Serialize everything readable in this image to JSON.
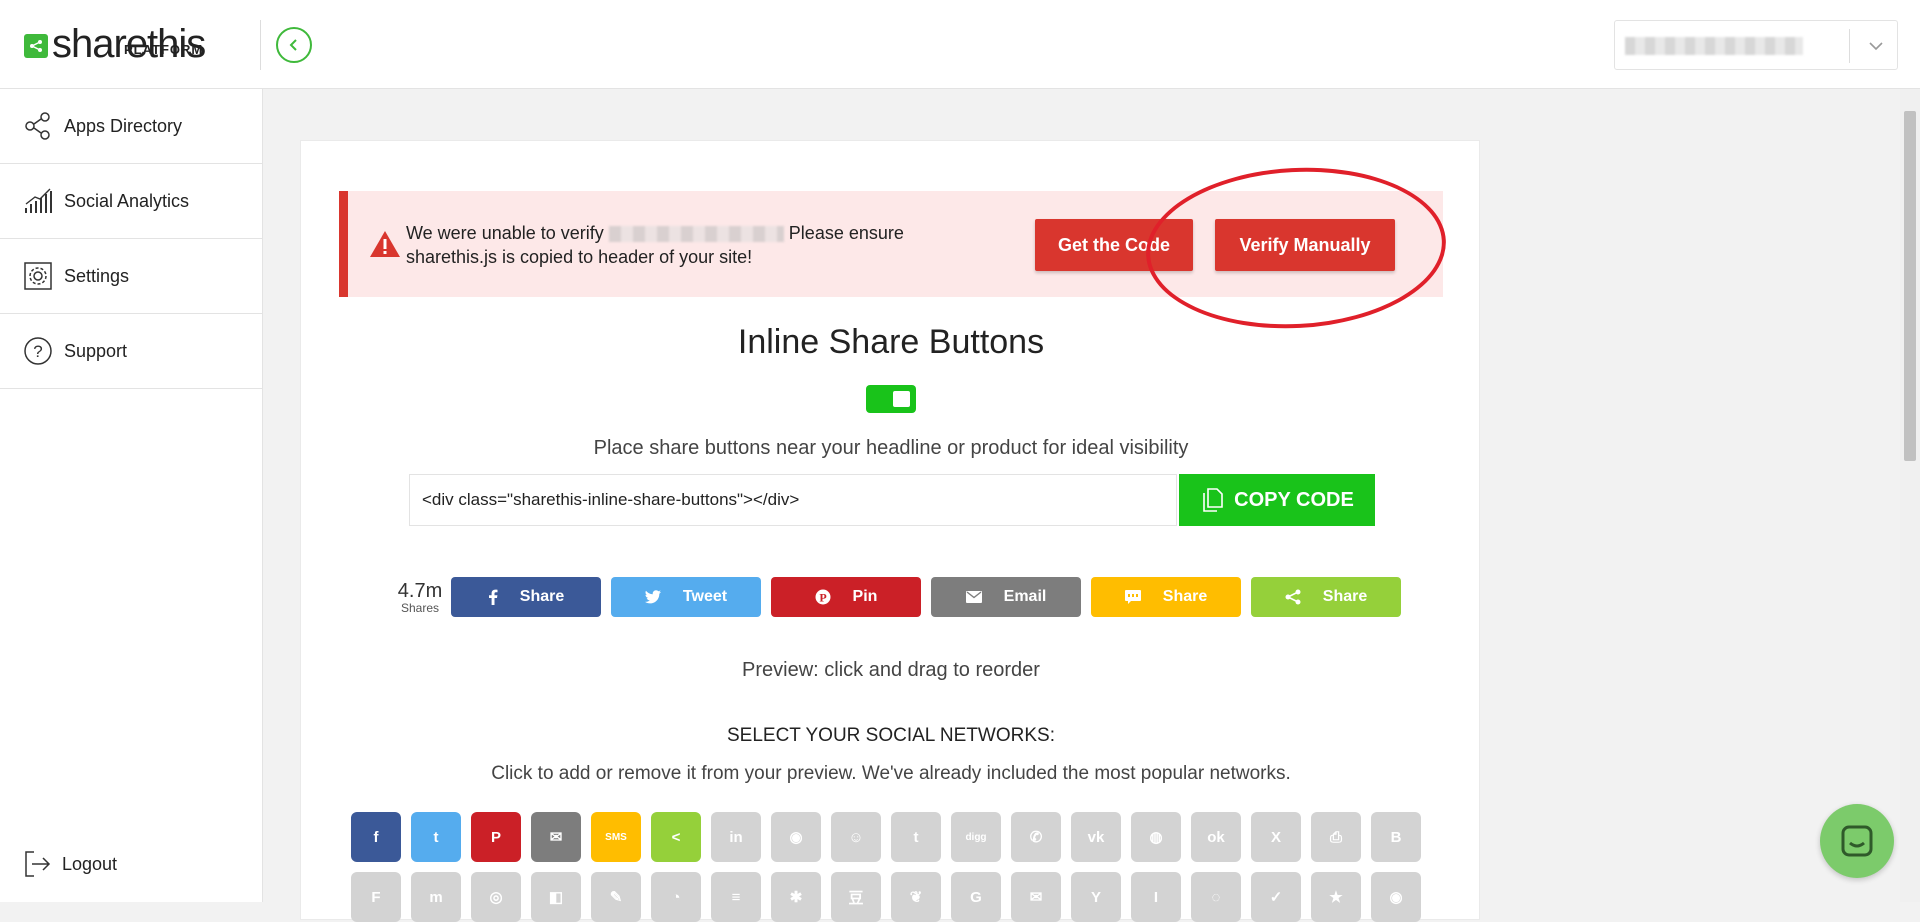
{
  "header": {
    "logo_text": "sharethis",
    "logo_sub": "PLATFORM",
    "account_selector": {
      "value": ""
    }
  },
  "sidebar": {
    "items": [
      {
        "label": "Apps Directory",
        "icon": "share-nodes-icon"
      },
      {
        "label": "Social Analytics",
        "icon": "bar-chart-icon"
      },
      {
        "label": "Settings",
        "icon": "gear-icon"
      },
      {
        "label": "Support",
        "icon": "question-icon"
      }
    ],
    "logout_label": "Logout"
  },
  "alert": {
    "text_before": "We were unable to verify",
    "text_after": "Please ensure sharethis.js is copied to header of your site!",
    "get_code_label": "Get the Code",
    "verify_label": "Verify Manually",
    "color": "#d9362e"
  },
  "main": {
    "title": "Inline Share Buttons",
    "toggle_on": true,
    "subtitle": "Place share buttons near your headline or product for ideal visibility",
    "code_value": "<div class=\"sharethis-inline-share-buttons\"></div>",
    "copy_label": "COPY CODE",
    "share_count": "4.7m",
    "share_count_label": "Shares",
    "preview_buttons": [
      {
        "label": "Share",
        "icon": "facebook-icon",
        "color": "#3b5998"
      },
      {
        "label": "Tweet",
        "icon": "twitter-icon",
        "color": "#55acee"
      },
      {
        "label": "Pin",
        "icon": "pinterest-icon",
        "color": "#cb2027"
      },
      {
        "label": "Email",
        "icon": "email-icon",
        "color": "#7d7d7d"
      },
      {
        "label": "Share",
        "icon": "sms-icon",
        "color": "#ffbd00"
      },
      {
        "label": "Share",
        "icon": "share-icon",
        "color": "#95d03a"
      }
    ],
    "preview_hint": "Preview: click and drag to reorder",
    "networks_title": "SELECT YOUR SOCIAL NETWORKS:",
    "networks_sub": "Click to add or remove it from your preview. We've already included the most popular networks."
  },
  "networks_row1": [
    {
      "name": "facebook",
      "glyph": "f",
      "color": "#3b5998",
      "active": true
    },
    {
      "name": "twitter",
      "glyph": "t",
      "color": "#55acee",
      "active": true
    },
    {
      "name": "pinterest",
      "glyph": "P",
      "color": "#cb2027",
      "active": true
    },
    {
      "name": "email",
      "glyph": "✉",
      "color": "#7d7d7d",
      "active": true
    },
    {
      "name": "sms",
      "glyph": "SMS",
      "color": "#ffbd00",
      "active": true
    },
    {
      "name": "sharethis",
      "glyph": "<",
      "color": "#95d03a",
      "active": true
    },
    {
      "name": "linkedin",
      "glyph": "in",
      "color": "#d3d3d3",
      "active": false
    },
    {
      "name": "messenger",
      "glyph": "◉",
      "color": "#d3d3d3",
      "active": false
    },
    {
      "name": "reddit",
      "glyph": "☺",
      "color": "#d3d3d3",
      "active": false
    },
    {
      "name": "tumblr",
      "glyph": "t",
      "color": "#d3d3d3",
      "active": false
    },
    {
      "name": "digg",
      "glyph": "digg",
      "color": "#d3d3d3",
      "active": false
    },
    {
      "name": "whatsapp",
      "glyph": "✆",
      "color": "#d3d3d3",
      "active": false
    },
    {
      "name": "vk",
      "glyph": "vk",
      "color": "#d3d3d3",
      "active": false
    },
    {
      "name": "weibo",
      "glyph": "◍",
      "color": "#d3d3d3",
      "active": false
    },
    {
      "name": "odnoklassniki",
      "glyph": "ok",
      "color": "#d3d3d3",
      "active": false
    },
    {
      "name": "xing",
      "glyph": "X",
      "color": "#d3d3d3",
      "active": false
    },
    {
      "name": "print",
      "glyph": "⎙",
      "color": "#d3d3d3",
      "active": false
    },
    {
      "name": "blogger",
      "glyph": "B",
      "color": "#d3d3d3",
      "active": false
    }
  ],
  "networks_row2": [
    {
      "name": "flipboard",
      "glyph": "F"
    },
    {
      "name": "meneame",
      "glyph": "m"
    },
    {
      "name": "periscope",
      "glyph": "◎"
    },
    {
      "name": "delicious",
      "glyph": "◧"
    },
    {
      "name": "livejournal",
      "glyph": "✎"
    },
    {
      "name": "wechat",
      "glyph": "◔"
    },
    {
      "name": "buffer",
      "glyph": "≡"
    },
    {
      "name": "yelp",
      "glyph": "✱"
    },
    {
      "name": "douban",
      "glyph": "豆"
    },
    {
      "name": "evernote",
      "glyph": "❦"
    },
    {
      "name": "google",
      "glyph": "G"
    },
    {
      "name": "gmail",
      "glyph": "✉"
    },
    {
      "name": "hacker-news",
      "glyph": "Y"
    },
    {
      "name": "instapaper",
      "glyph": "I"
    },
    {
      "name": "line",
      "glyph": "◌"
    },
    {
      "name": "pocket",
      "glyph": "✓"
    },
    {
      "name": "bookmark",
      "glyph": "★"
    },
    {
      "name": "other",
      "glyph": "◉"
    }
  ]
}
